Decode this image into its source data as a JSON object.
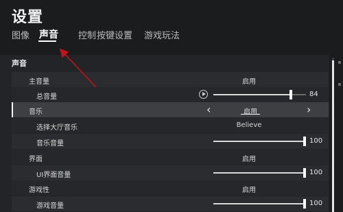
{
  "page_title": "设置",
  "tabs": [
    {
      "label": "图像"
    },
    {
      "label": "声音",
      "active": true
    },
    {
      "label": "控制"
    },
    {
      "label": "按键设置"
    },
    {
      "label": "游戏玩法"
    }
  ],
  "section": {
    "title": "声音"
  },
  "rows": [
    {
      "label": "主音量",
      "value": "启用"
    },
    {
      "label": "总音量",
      "slider": 0.84,
      "number": "84",
      "icon": "play-icon"
    },
    {
      "label": "音乐",
      "value": "启用",
      "selected": true,
      "icons": [
        "chevron-left-icon",
        "chevron-right-icon"
      ]
    },
    {
      "label": "选择大厅音乐",
      "value": "Believe"
    },
    {
      "label": "音乐音量",
      "slider": 1.0,
      "number": "100"
    },
    {
      "label": "界面",
      "value": "启用"
    },
    {
      "label": "UI界面音量",
      "slider": 1.0,
      "number": "100"
    },
    {
      "label": "游戏性",
      "value": "启用"
    },
    {
      "label": "游戏音量",
      "slider": 1.0,
      "number": "100"
    }
  ],
  "colors": {
    "background": "#1b1c1e",
    "annotation_arrow": "#c0141a",
    "accent": "#ffffff"
  }
}
